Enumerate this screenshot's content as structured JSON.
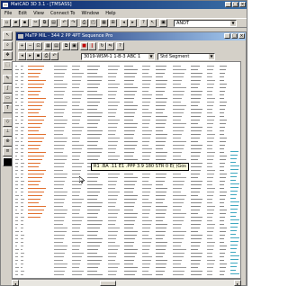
{
  "app": {
    "title": "MatCAD 3D 3.1 - [TMSASS]",
    "menu": [
      "File",
      "Edit",
      "View",
      "Connect To",
      "Window",
      "Help"
    ],
    "toolbar_combo": "ANDT",
    "window_buttons": [
      "_",
      "□",
      "×"
    ]
  },
  "document": {
    "title": "MaTP MIL - 344 2 PP 4PT Sequence Pro",
    "layer_combo": "3019-WSM-1 1-B-3 ABC 1",
    "mode_combo": "Std Segment"
  },
  "tools": {
    "left": [
      "arrow",
      "zoom",
      "pan",
      "select",
      "pencil",
      "curve",
      "rect",
      "text",
      "node",
      "measure",
      "snap",
      "layer",
      "color",
      "fill"
    ],
    "doc_row1": [
      "zoom-in",
      "zoom-out",
      "fit",
      "grid",
      "copy",
      "paste",
      "stop",
      "ok",
      "rotate",
      "flip",
      "help"
    ],
    "doc_row2": [
      "prev",
      "next",
      "save",
      "print",
      "undo"
    ]
  },
  "tooltip": {
    "text": "R1 .BA .11 E1 .PPP 3.9 180 STR 0 E(      )Gos"
  },
  "colors": {
    "accent": "#0a246a",
    "orange": "#e07030",
    "cyan": "#40a8c0",
    "gray": "#8a8a8a"
  }
}
